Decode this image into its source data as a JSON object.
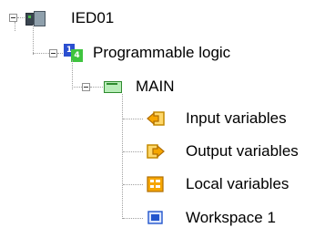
{
  "tree": {
    "root": {
      "label": "IED01",
      "icon": "ied-device-icon",
      "expanded": true
    },
    "logic": {
      "label": "Programmable logic",
      "icon": "programmable-logic-icon",
      "expanded": true
    },
    "main": {
      "label": "MAIN",
      "icon": "main-program-icon",
      "expanded": true
    },
    "children": [
      {
        "label": "Input variables",
        "icon": "input-variables-icon",
        "color": "#f5a300"
      },
      {
        "label": "Output variables",
        "icon": "output-variables-icon",
        "color": "#f5a300"
      },
      {
        "label": "Local variables",
        "icon": "local-variables-icon",
        "color": "#f5a300"
      },
      {
        "label": "Workspace 1",
        "icon": "workspace-icon",
        "color": "#2255cc"
      }
    ]
  },
  "badges": {
    "logic_left": "1",
    "logic_right": "4"
  }
}
